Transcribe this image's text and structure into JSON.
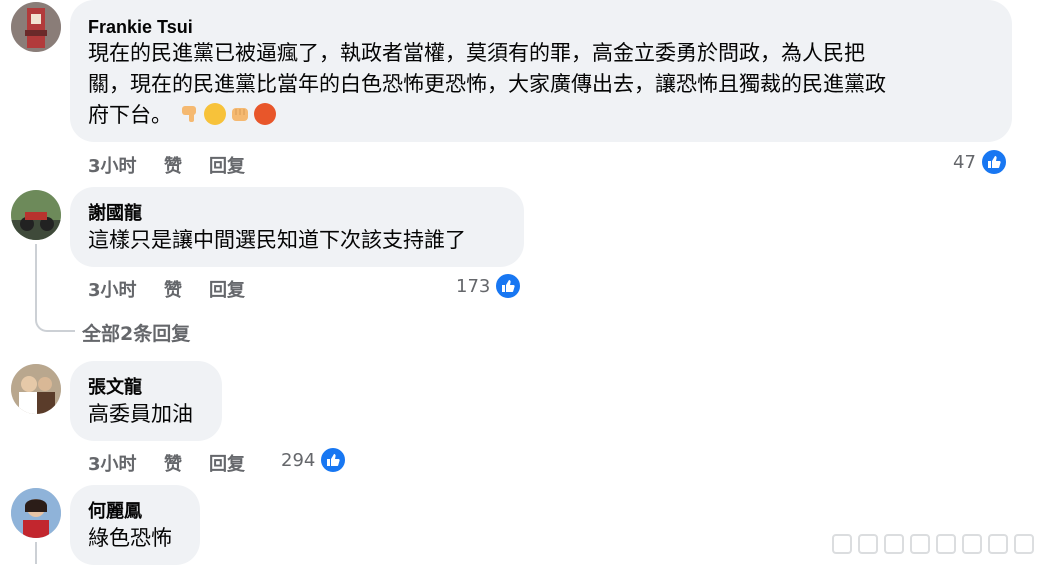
{
  "colors": {
    "like_blue": "#1877f2",
    "bubble_bg": "#f0f2f5",
    "meta_gray": "#65676b"
  },
  "comments": [
    {
      "author": "Frankie Tsui",
      "text_lines": [
        "現在的民進黨已被逼瘋了，執政者當權，莫須有的罪，高金立委勇於問政，為人民把",
        "關，現在的民進黨比當年的白色恐怖更恐怖，大家廣傳出去，讓恐怖且獨裁的民進黨政",
        "府下台。"
      ],
      "emojis": [
        "thumbs-down-emoji",
        "tired-face-emoji",
        "fist-emoji",
        "angry-face-emoji"
      ],
      "time": "3小时",
      "like_label": "赞",
      "reply_label": "回复",
      "like_count": "47"
    },
    {
      "author": "謝國龍",
      "text": "這樣只是讓中間選民知道下次該支持誰了",
      "time": "3小时",
      "like_label": "赞",
      "reply_label": "回复",
      "like_count": "173",
      "view_replies": "全部2条回复"
    },
    {
      "author": "張文龍",
      "text": "高委員加油",
      "time": "3小时",
      "like_label": "赞",
      "reply_label": "回复",
      "like_count": "294"
    },
    {
      "author": "何麗鳳",
      "text": "綠色恐怖"
    }
  ]
}
